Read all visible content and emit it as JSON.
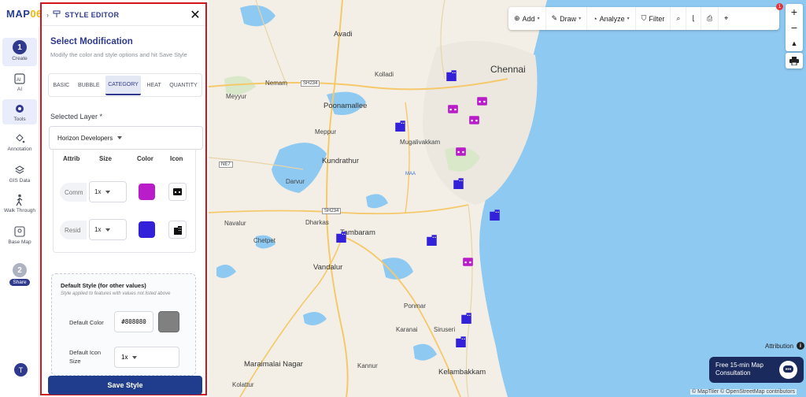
{
  "app": {
    "logo_main": "MAP",
    "logo_accent": "06"
  },
  "rail": {
    "create_step": "1",
    "create_label": "Create",
    "ai_label": "AI",
    "tools_label": "Tools",
    "annotation_label": "Annotation",
    "gis_label": "GIS Data",
    "walk_label": "Walk Through",
    "basemap_label": "Base Map",
    "share_step": "2",
    "share_label": "Share",
    "user_initial": "T"
  },
  "panel": {
    "title": "STYLE EDITOR",
    "section_title": "Select Modification",
    "section_sub": "Modify the color and style options and hit Save Style",
    "tabs": [
      "BASIC",
      "BUBBLE",
      "CATEGORY",
      "HEAT",
      "QUANTITY"
    ],
    "active_tab": "CATEGORY",
    "layer_label": "Selected Layer *",
    "layer_value": "Horizon Developers",
    "grid_headers": {
      "attrib": "Attrib",
      "size": "Size",
      "color": "Color",
      "icon": "Icon"
    },
    "rows": [
      {
        "attrib": "Comm",
        "size": "1x",
        "color": "#b81dc9",
        "icon": "storefront-icon"
      },
      {
        "attrib": "Resid",
        "size": "1x",
        "color": "#3221d9",
        "icon": "apartment-icon"
      }
    ],
    "default_title": "Default Style (for other values)",
    "default_sub": "Style applied to features with values not listed above",
    "default_color_label": "Default Color",
    "default_color_value": "#808080",
    "default_icon_size_label1": "Default Icon",
    "default_icon_size_label2": "Size",
    "default_icon_size_value": "1x",
    "save_label": "Save Style"
  },
  "map": {
    "places": {
      "avadi": "Avadi",
      "chennai": "Chennai",
      "poonamallee": "Poonamallee",
      "nemam": "Nemam",
      "meyyur": "Meyyur",
      "kolladi": "Kolladi",
      "meppur": "Meppur",
      "mugalivakkam": "Mugalivakkam",
      "kundrathur": "Kundrathur",
      "darvur": "Darvur",
      "naval": "Navalur",
      "tambaram": "Tambaram",
      "dharkas": "Dharkas",
      "chetpet": "Chetpet",
      "vandalur": "Vandalur",
      "ponmar": "Ponmar",
      "siruseri": "Siruseri",
      "maraimalai": "Maraimalai Nagar",
      "kelambakkam": "Kelambakkam",
      "kolathur": "Kolattur",
      "kannur": "Kannur",
      "maa": "MAA",
      "karanai": "Karanai"
    },
    "shields": {
      "sh234a": "SH234",
      "sh234b": "SH234",
      "ne7": "NE7"
    },
    "toolbar": {
      "add": "Add",
      "draw": "Draw",
      "analyze": "Analyze",
      "filter": "Filter"
    },
    "notification_count": "1",
    "attribution": "Attribution",
    "consult_line1": "Free 15-min Map",
    "consult_line2": "Consultation",
    "copyright": "© MapTiler © OpenStreetMap contributors",
    "colors": {
      "sea": "#8ec9f2",
      "land": "#f3efe6",
      "commercial": "#b81dc9",
      "residential": "#3221d9"
    }
  }
}
